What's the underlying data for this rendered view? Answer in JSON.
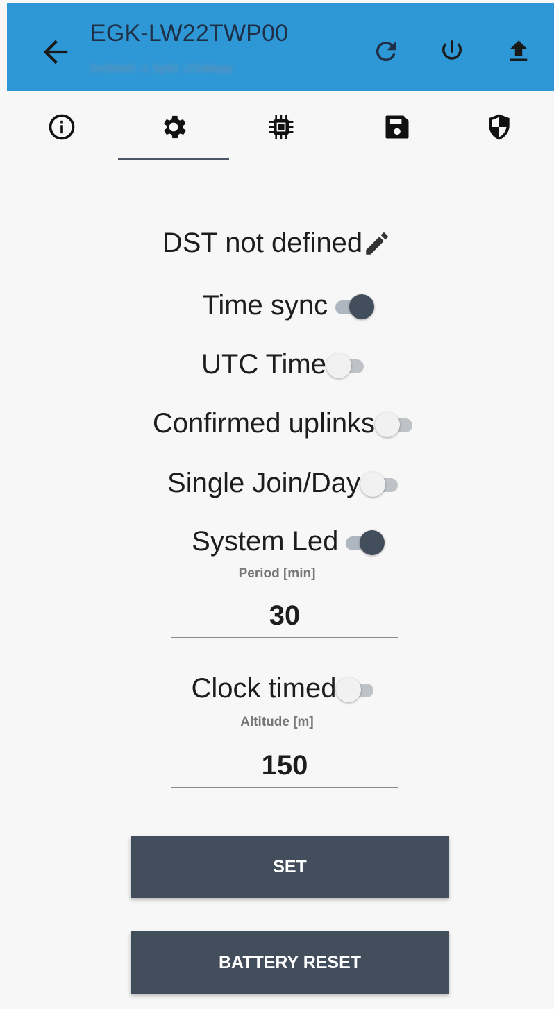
{
  "header": {
    "title": "EGK-LW22TWP00",
    "subtitle": "0x0b9d5 ›1 5p92 ›2Sdtlepp",
    "icons": [
      "back-arrow-icon",
      "refresh-icon",
      "power-icon",
      "upload-icon"
    ]
  },
  "tabs": [
    {
      "name": "info",
      "icon": "info-icon"
    },
    {
      "name": "settings",
      "icon": "gear-icon",
      "active": true
    },
    {
      "name": "hardware",
      "icon": "chip-icon"
    },
    {
      "name": "storage",
      "icon": "save-icon"
    },
    {
      "name": "security",
      "icon": "shield-icon"
    }
  ],
  "settings": {
    "dst_label": "DST not defined",
    "time_sync": {
      "label": "Time sync",
      "on": true
    },
    "utc_time": {
      "label": "UTC Time",
      "on": false
    },
    "confirmed_uplinks": {
      "label": "Confirmed uplinks",
      "on": false
    },
    "single_join": {
      "label": "Single Join/Day",
      "on": false
    },
    "system_led": {
      "label": "System Led",
      "on": true
    },
    "period": {
      "label": "Period [min]",
      "value": "30"
    },
    "clock_timed": {
      "label": "Clock timed",
      "on": false
    },
    "altitude": {
      "label": "Altitude [m]",
      "value": "150"
    }
  },
  "buttons": {
    "set": "SET",
    "battery_reset": "BATTERY RESET"
  },
  "colors": {
    "header": "#2e98d6",
    "accent": "#434e5d",
    "background": "#f7f7f7"
  }
}
